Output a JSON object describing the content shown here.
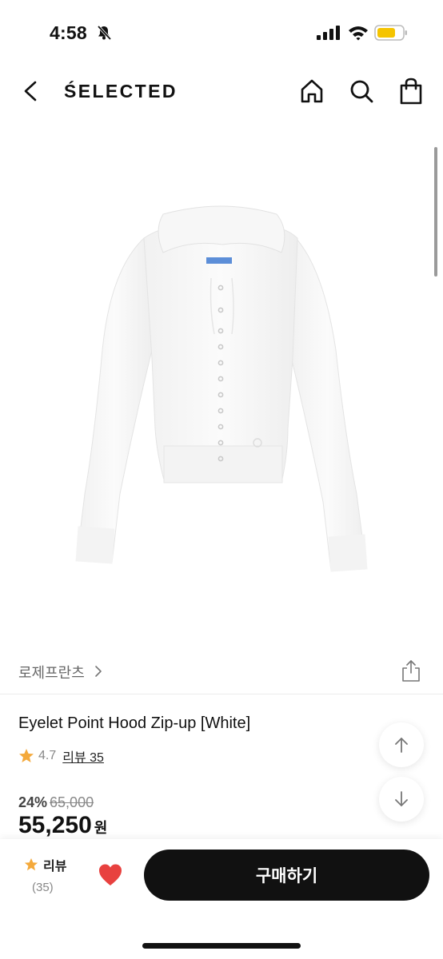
{
  "status_bar": {
    "time": "4:58",
    "icons": [
      "bell-off-icon",
      "signal-icon",
      "wifi-icon",
      "battery-icon"
    ],
    "battery_color": "#f5c400"
  },
  "header": {
    "brand": "ŚELECTED",
    "icons": [
      "back-icon",
      "home-icon",
      "search-icon",
      "bag-icon"
    ]
  },
  "product": {
    "brand_name": "로제프란츠",
    "title": "Eyelet Point Hood Zip-up [White]",
    "rating": "4.7",
    "review_label": "리뷰 35",
    "discount_rate": "24%",
    "original_price": "65,000",
    "sale_price": "55,250",
    "currency_unit": "원",
    "image_label": "white cropped hoodie product image"
  },
  "bottom_bar": {
    "review_label": "리뷰",
    "review_count": "(35)",
    "buy_label": "구매하기"
  },
  "colors": {
    "star": "#f4a93b",
    "heart": "#e8413f",
    "buy_button": "#111111"
  }
}
